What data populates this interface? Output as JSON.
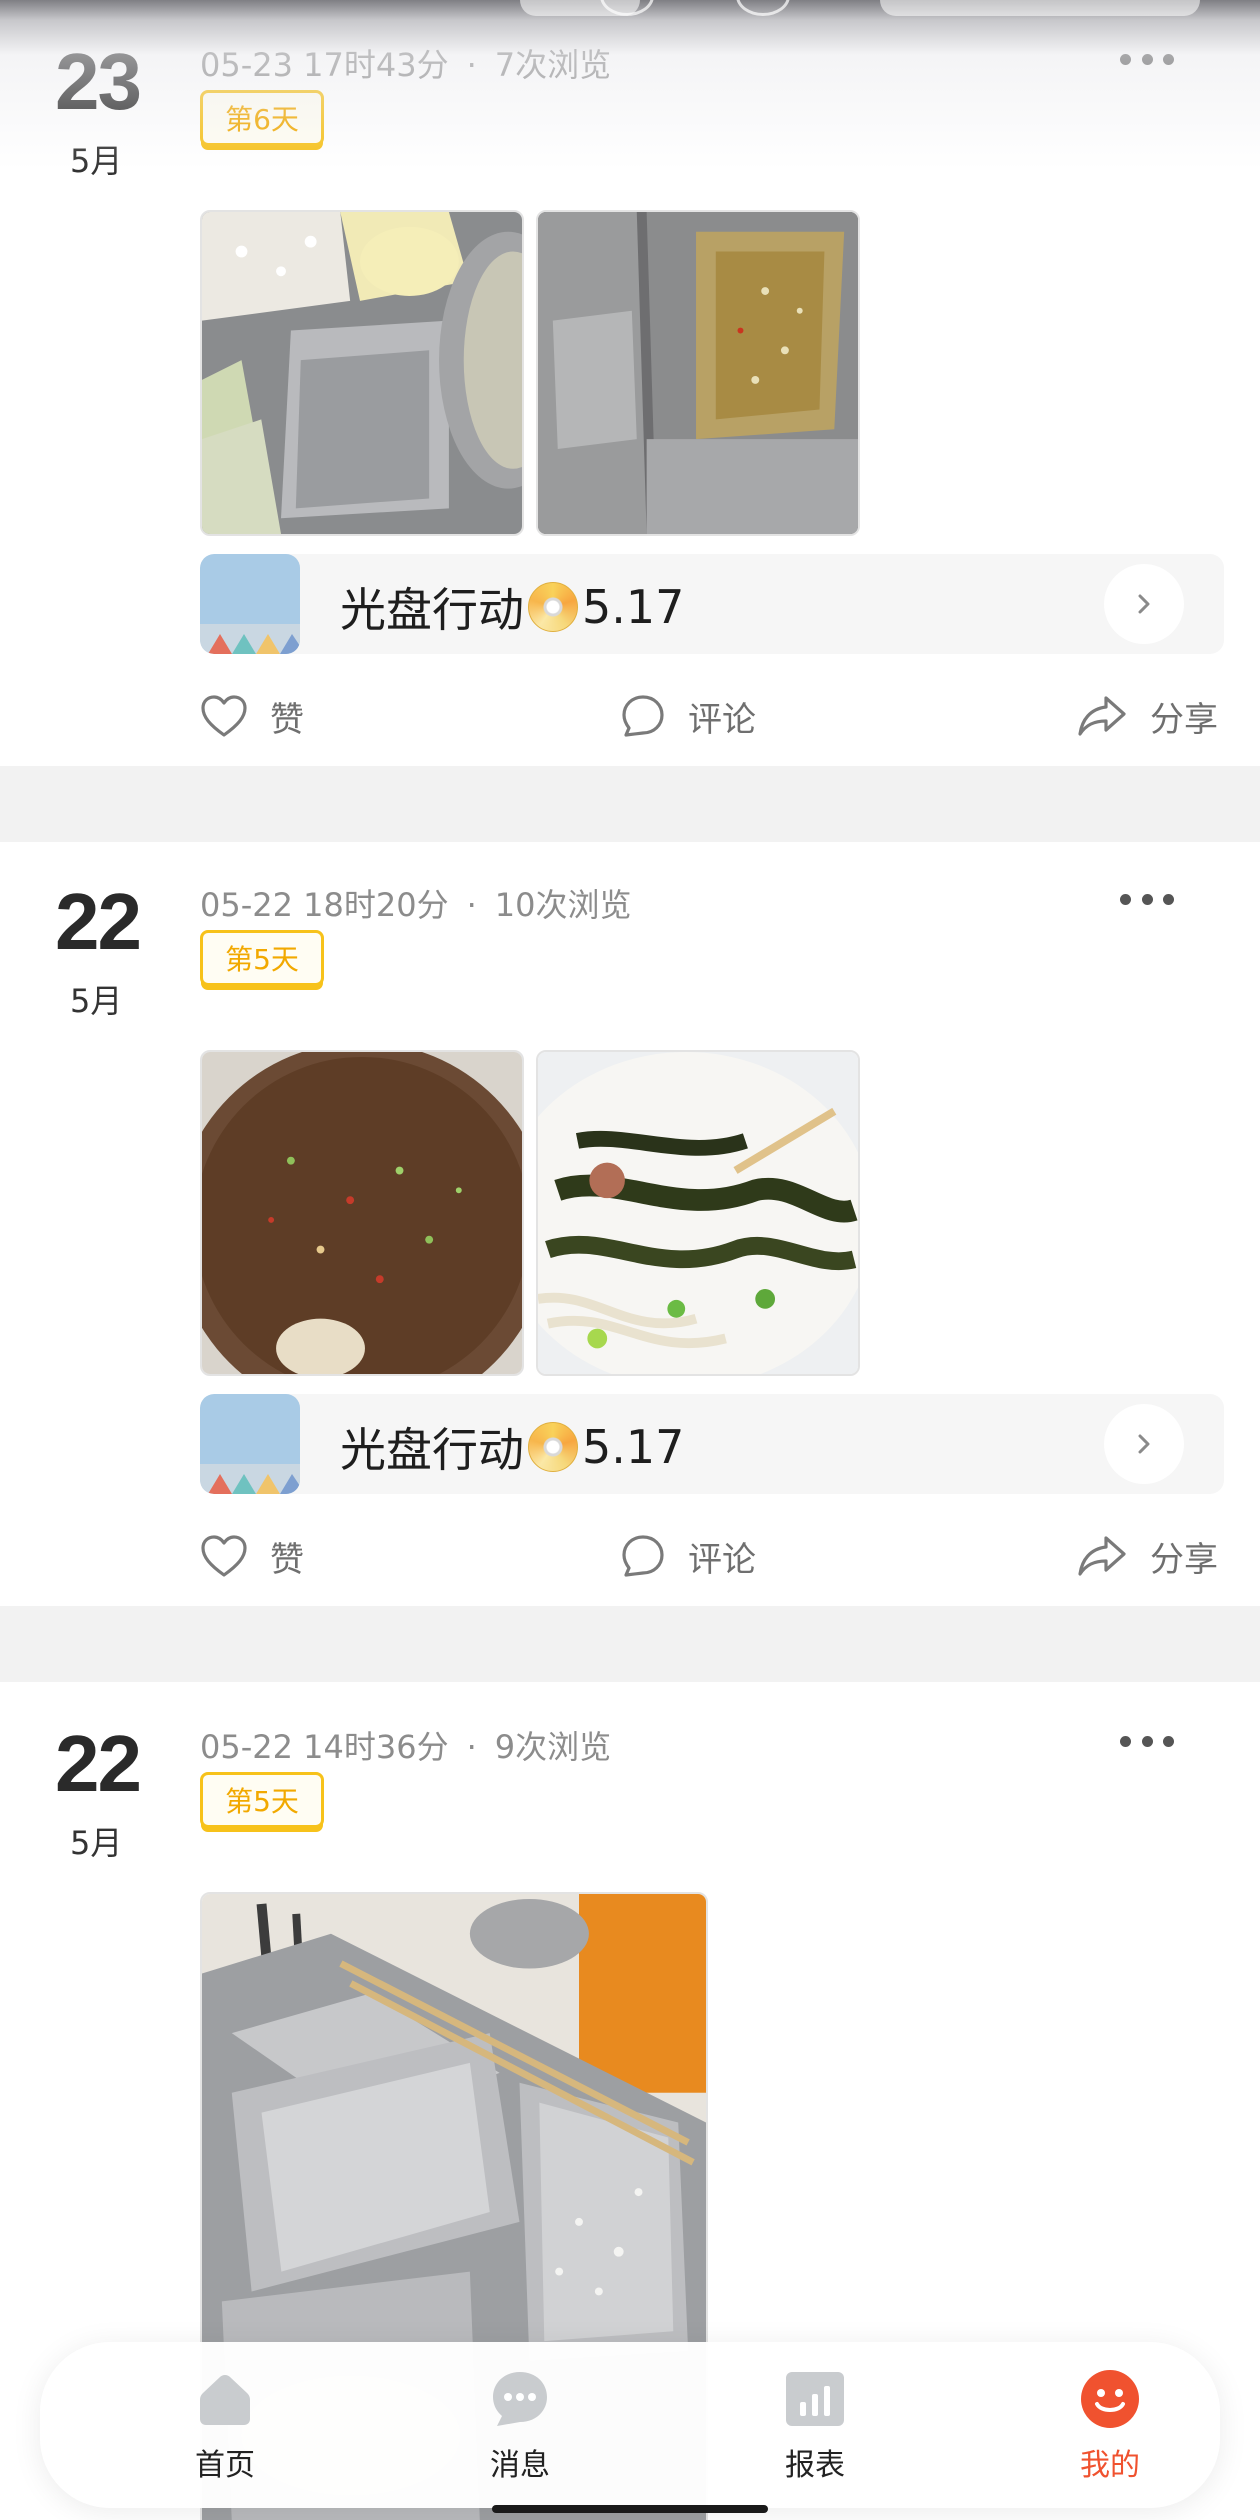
{
  "posts": [
    {
      "day": "23",
      "month": "5月",
      "time": "05-23 17时43分",
      "views": "7次浏览",
      "dot": "·",
      "badge": "第6天",
      "topic": {
        "title": "光盘行动",
        "suffix": "5.17"
      },
      "photos": [
        "tray-rice-cabbage",
        "tray-soup"
      ],
      "actions": {
        "like": "赞",
        "comment": "评论",
        "share": "分享"
      }
    },
    {
      "day": "22",
      "month": "5月",
      "time": "05-22 18时20分",
      "views": "10次浏览",
      "dot": "·",
      "badge": "第5天",
      "topic": {
        "title": "光盘行动",
        "suffix": "5.17"
      },
      "photos": [
        "bowl-soup",
        "noodles-kelp"
      ],
      "actions": {
        "like": "赞",
        "comment": "评论",
        "share": "分享"
      }
    },
    {
      "day": "22",
      "month": "5月",
      "time": "05-22 14时36分",
      "views": "9次浏览",
      "dot": "·",
      "badge": "第5天",
      "photos": [
        "empty-tray-chopsticks"
      ]
    }
  ],
  "tabbar": {
    "items": [
      {
        "label": "首页",
        "icon": "home-icon"
      },
      {
        "label": "消息",
        "icon": "message-icon"
      },
      {
        "label": "报表",
        "icon": "chart-icon"
      },
      {
        "label": "我的",
        "icon": "smiley-icon",
        "active": true
      }
    ]
  },
  "colors": {
    "accent": "#f0522f",
    "badge": "#f7c21a",
    "muted": "#8c8c8c"
  }
}
